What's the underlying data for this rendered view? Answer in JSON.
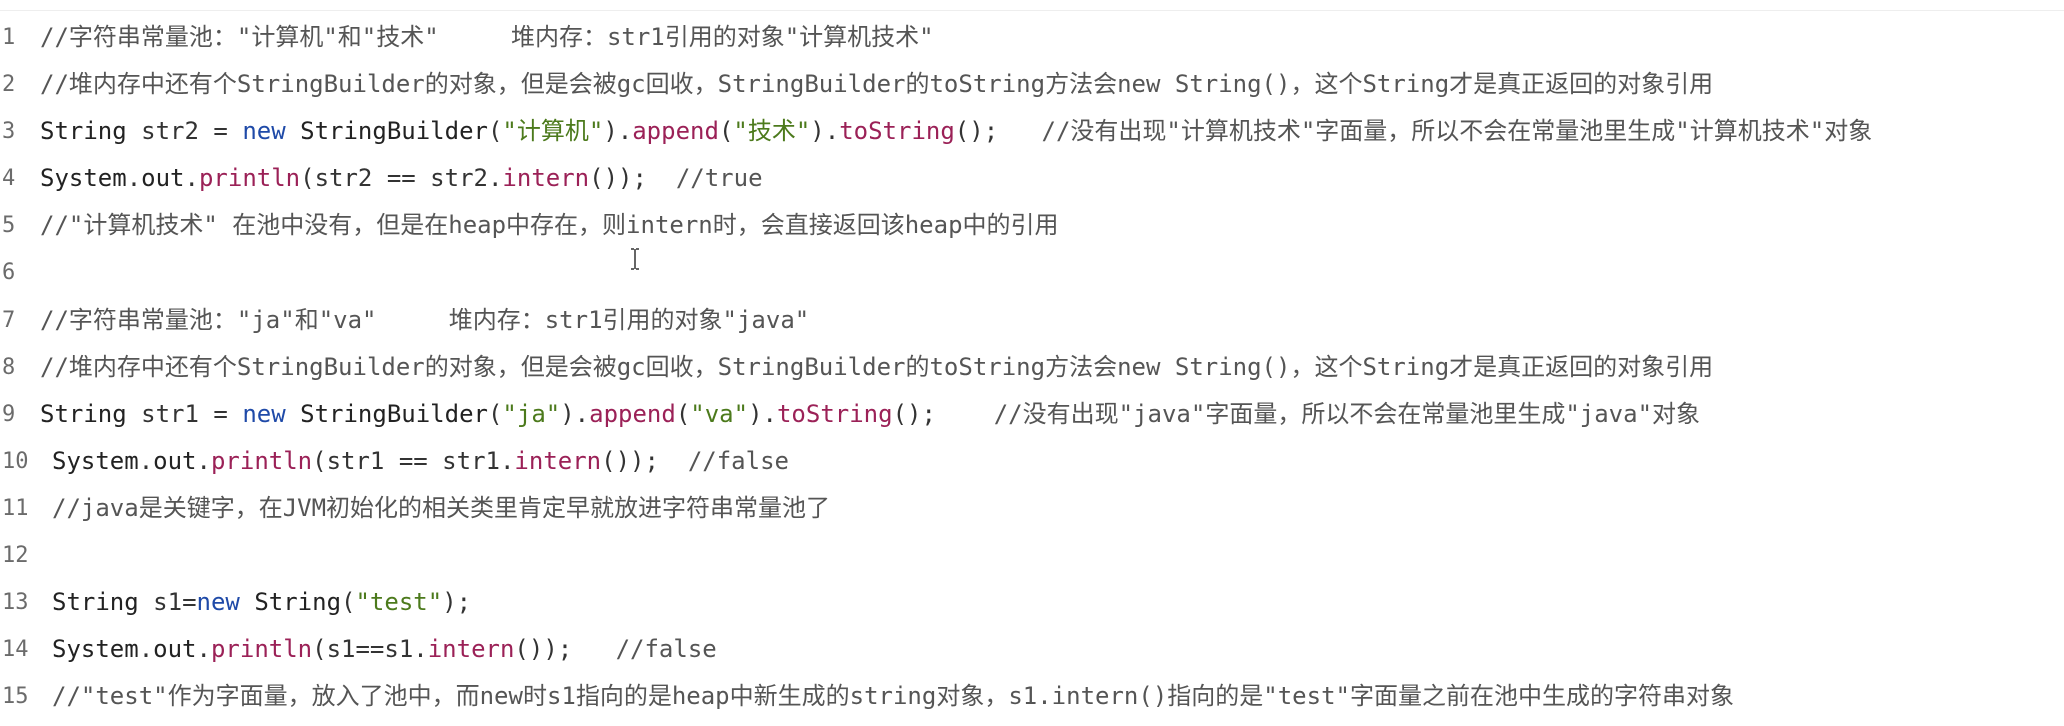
{
  "editor": {
    "lines": [
      {
        "n": "1",
        "indent": false,
        "tokens": [
          {
            "t": "//字符串常量池：\"计算机\"和\"技术\"     堆内存：str1引用的对象\"计算机技术\"",
            "k": "cm"
          }
        ]
      },
      {
        "n": "2",
        "indent": false,
        "tokens": [
          {
            "t": "//堆内存中还有个StringBuilder的对象，但是会被gc回收，StringBuilder的toString方法会new String()，这个String才是真正返回的对象引用",
            "k": "cm"
          }
        ]
      },
      {
        "n": "3",
        "indent": false,
        "tokens": [
          {
            "t": "String",
            "k": "ty"
          },
          {
            "t": " str2 ",
            "k": "op"
          },
          {
            "t": "=",
            "k": "op"
          },
          {
            "t": " ",
            "k": "op"
          },
          {
            "t": "new",
            "k": "kw"
          },
          {
            "t": " ",
            "k": "op"
          },
          {
            "t": "StringBuilder",
            "k": "ty"
          },
          {
            "t": "(",
            "k": "op"
          },
          {
            "t": "\"计算机\"",
            "k": "st"
          },
          {
            "t": ").",
            "k": "op"
          },
          {
            "t": "append",
            "k": "fn"
          },
          {
            "t": "(",
            "k": "op"
          },
          {
            "t": "\"技术\"",
            "k": "st"
          },
          {
            "t": ").",
            "k": "op"
          },
          {
            "t": "toString",
            "k": "fn"
          },
          {
            "t": "();   ",
            "k": "op"
          },
          {
            "t": "//没有出现\"计算机技术\"字面量，所以不会在常量池里生成\"计算机技术\"对象",
            "k": "cm"
          }
        ]
      },
      {
        "n": "4",
        "indent": false,
        "tokens": [
          {
            "t": "System",
            "k": "ty"
          },
          {
            "t": ".",
            "k": "op"
          },
          {
            "t": "out",
            "k": "ty"
          },
          {
            "t": ".",
            "k": "op"
          },
          {
            "t": "println",
            "k": "fn"
          },
          {
            "t": "(str2 == str2.",
            "k": "op"
          },
          {
            "t": "intern",
            "k": "fn"
          },
          {
            "t": "());  ",
            "k": "op"
          },
          {
            "t": "//true",
            "k": "cm"
          }
        ]
      },
      {
        "n": "5",
        "indent": false,
        "tokens": [
          {
            "t": "//\"计算机技术\" 在池中没有，但是在heap中存在，则intern时，会直接返回该heap中的引用",
            "k": "cm"
          }
        ]
      },
      {
        "n": "6",
        "indent": false,
        "tokens": []
      },
      {
        "n": "7",
        "indent": false,
        "tokens": [
          {
            "t": "//字符串常量池：\"ja\"和\"va\"     堆内存：str1引用的对象\"java\"",
            "k": "cm"
          }
        ]
      },
      {
        "n": "8",
        "indent": false,
        "tokens": [
          {
            "t": "//堆内存中还有个StringBuilder的对象，但是会被gc回收，StringBuilder的toString方法会new String()，这个String才是真正返回的对象引用",
            "k": "cm"
          }
        ]
      },
      {
        "n": "9",
        "indent": false,
        "tokens": [
          {
            "t": "String",
            "k": "ty"
          },
          {
            "t": " str1 ",
            "k": "op"
          },
          {
            "t": "=",
            "k": "op"
          },
          {
            "t": " ",
            "k": "op"
          },
          {
            "t": "new",
            "k": "kw"
          },
          {
            "t": " ",
            "k": "op"
          },
          {
            "t": "StringBuilder",
            "k": "ty"
          },
          {
            "t": "(",
            "k": "op"
          },
          {
            "t": "\"ja\"",
            "k": "st"
          },
          {
            "t": ").",
            "k": "op"
          },
          {
            "t": "append",
            "k": "fn"
          },
          {
            "t": "(",
            "k": "op"
          },
          {
            "t": "\"va\"",
            "k": "st"
          },
          {
            "t": ").",
            "k": "op"
          },
          {
            "t": "toString",
            "k": "fn"
          },
          {
            "t": "();    ",
            "k": "op"
          },
          {
            "t": "//没有出现\"java\"字面量，所以不会在常量池里生成\"java\"对象",
            "k": "cm"
          }
        ]
      },
      {
        "n": "10",
        "indent": true,
        "tokens": [
          {
            "t": "System",
            "k": "ty"
          },
          {
            "t": ".",
            "k": "op"
          },
          {
            "t": "out",
            "k": "ty"
          },
          {
            "t": ".",
            "k": "op"
          },
          {
            "t": "println",
            "k": "fn"
          },
          {
            "t": "(str1 == str1.",
            "k": "op"
          },
          {
            "t": "intern",
            "k": "fn"
          },
          {
            "t": "());  ",
            "k": "op"
          },
          {
            "t": "//false",
            "k": "cm"
          }
        ]
      },
      {
        "n": "11",
        "indent": true,
        "tokens": [
          {
            "t": "//java是关键字，在JVM初始化的相关类里肯定早就放进字符串常量池了",
            "k": "cm"
          }
        ]
      },
      {
        "n": "12",
        "indent": false,
        "tokens": []
      },
      {
        "n": "13",
        "indent": true,
        "tokens": [
          {
            "t": "String",
            "k": "ty"
          },
          {
            "t": " s1",
            "k": "op"
          },
          {
            "t": "=",
            "k": "op"
          },
          {
            "t": "new",
            "k": "kw"
          },
          {
            "t": " ",
            "k": "op"
          },
          {
            "t": "String",
            "k": "ty"
          },
          {
            "t": "(",
            "k": "op"
          },
          {
            "t": "\"test\"",
            "k": "st"
          },
          {
            "t": ");",
            "k": "op"
          }
        ]
      },
      {
        "n": "14",
        "indent": true,
        "tokens": [
          {
            "t": "System",
            "k": "ty"
          },
          {
            "t": ".",
            "k": "op"
          },
          {
            "t": "out",
            "k": "ty"
          },
          {
            "t": ".",
            "k": "op"
          },
          {
            "t": "println",
            "k": "fn"
          },
          {
            "t": "(s1==s1.",
            "k": "op"
          },
          {
            "t": "intern",
            "k": "fn"
          },
          {
            "t": "());   ",
            "k": "op"
          },
          {
            "t": "//false",
            "k": "cm"
          }
        ]
      },
      {
        "n": "15",
        "indent": true,
        "tokens": [
          {
            "t": "//\"test\"作为字面量，放入了池中，而new时s1指向的是heap中新生成的string对象，s1.intern()指向的是\"test\"字面量之前在池中生成的字符串对象",
            "k": "cm"
          }
        ]
      }
    ]
  },
  "colors": {
    "comment": "#555555",
    "keyword": "#1f4aa8",
    "string": "#4c7a1c",
    "method": "#9b2157",
    "text": "#333333",
    "line_number": "#6b6b6b",
    "background": "#ffffff"
  },
  "icons": {
    "cursor": "text-cursor-ibeam-icon"
  }
}
